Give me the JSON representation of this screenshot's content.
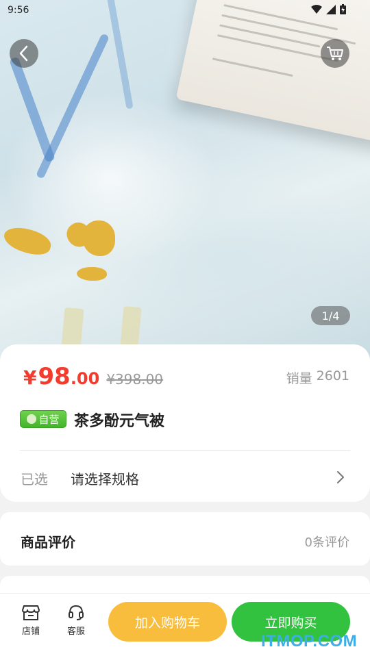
{
  "status_bar": {
    "time": "9:56"
  },
  "gallery": {
    "pager": "1/4"
  },
  "product": {
    "price_symbol": "¥",
    "price_integer": "98",
    "price_decimal": ".00",
    "original_price": "¥398.00",
    "sales_label": "销量",
    "sales_count": "2601",
    "badge": "自营",
    "title": "茶多酚元气被"
  },
  "spec": {
    "label": "已选",
    "value": "请选择规格"
  },
  "reviews": {
    "title": "商品评价",
    "count": "0条评价"
  },
  "bottom_bar": {
    "shop_label": "店铺",
    "service_label": "客服",
    "add_to_cart": "加入购物车",
    "buy_now": "立即购买"
  },
  "watermark": "ITMOP.COM",
  "colors": {
    "price": "#f23c2e",
    "add_to_cart": "#f8bd3c",
    "buy_now": "#32c23f",
    "badge": "#43b42b"
  }
}
